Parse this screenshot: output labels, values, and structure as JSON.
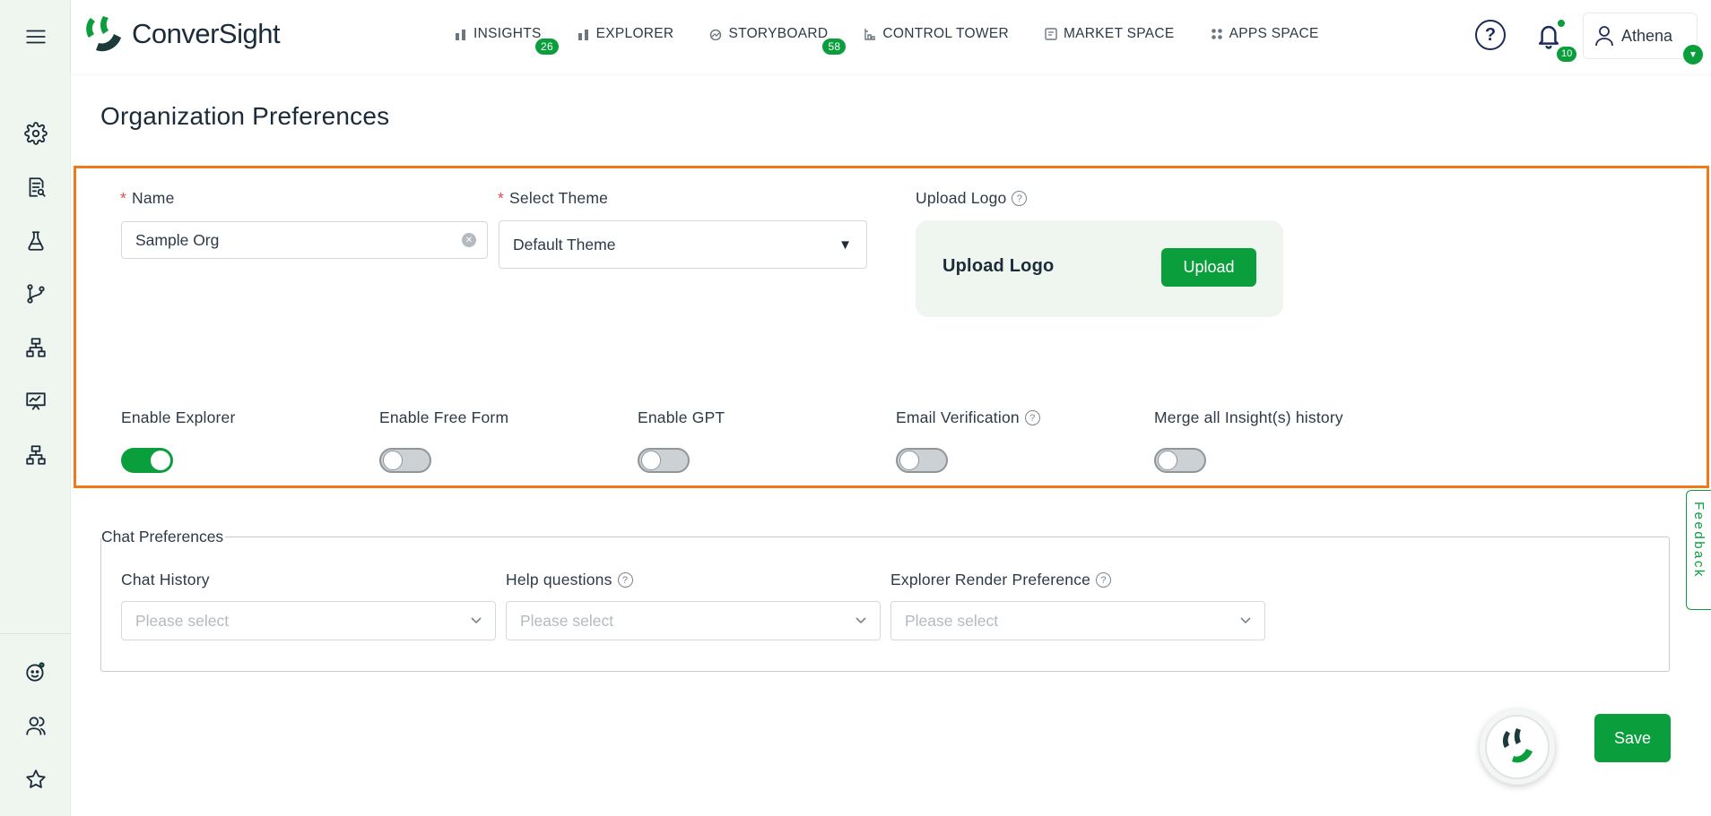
{
  "app": {
    "logo_text": "ConverSight"
  },
  "nav": {
    "items": [
      {
        "label": "INSIGHTS",
        "badge": "26"
      },
      {
        "label": "EXPLORER"
      },
      {
        "label": "STORYBOARD",
        "badge": "58"
      },
      {
        "label": "CONTROL TOWER"
      },
      {
        "label": "MARKET SPACE"
      },
      {
        "label": "APPS SPACE"
      }
    ]
  },
  "header": {
    "help": "?",
    "notifications_badge": "10",
    "user_name": "Athena"
  },
  "sidebar": {
    "icons": [
      "menu-icon",
      "settings-icon",
      "report-icon",
      "flask-icon",
      "branch-icon",
      "hierarchy-icon",
      "presentation-icon",
      "hierarchy-icon",
      "bot-face-icon",
      "users-icon",
      "star-icon"
    ]
  },
  "page": {
    "title": "Organization Preferences"
  },
  "form": {
    "name_label": "Name",
    "name_value": "Sample Org",
    "theme_label": "Select Theme",
    "theme_value": "Default Theme",
    "upload_label": "Upload Logo",
    "upload_box_label": "Upload Logo",
    "upload_button": "Upload",
    "toggles": [
      {
        "label": "Enable Explorer",
        "on": true
      },
      {
        "label": "Enable Free Form",
        "on": false
      },
      {
        "label": "Enable GPT",
        "on": false
      },
      {
        "label": "Email Verification",
        "on": false,
        "help": true
      },
      {
        "label": "Merge all Insight(s) history",
        "on": false
      }
    ]
  },
  "chat": {
    "legend": "Chat Preferences",
    "fields": [
      {
        "label": "Chat History",
        "placeholder": "Please select"
      },
      {
        "label": "Help questions",
        "placeholder": "Please select",
        "help": true
      },
      {
        "label": "Explorer Render Preference",
        "placeholder": "Please select",
        "help": true
      }
    ]
  },
  "feedback_label": "Feedback",
  "save_label": "Save",
  "colors": {
    "brand_green": "#0a9e3c",
    "highlight_orange": "#f07a1a",
    "sidebar_bg": "#eef6ef"
  }
}
